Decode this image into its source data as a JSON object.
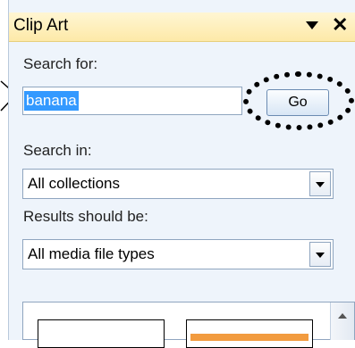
{
  "panel": {
    "title": "Clip Art",
    "menu_icon": "dropdown-triangle-icon",
    "close_icon": "close-x-icon"
  },
  "search": {
    "label": "Search for:",
    "value": "banana",
    "go_label": "Go"
  },
  "search_in": {
    "label": "Search in:",
    "selected": "All collections"
  },
  "results_type": {
    "label": "Results should be:",
    "selected": "All media file types"
  },
  "colors": {
    "title_bar": "#fde9a8",
    "pane_bg": "#eef4fb",
    "selection": "#3399ff",
    "thumb_accent": "#f29b3f"
  }
}
